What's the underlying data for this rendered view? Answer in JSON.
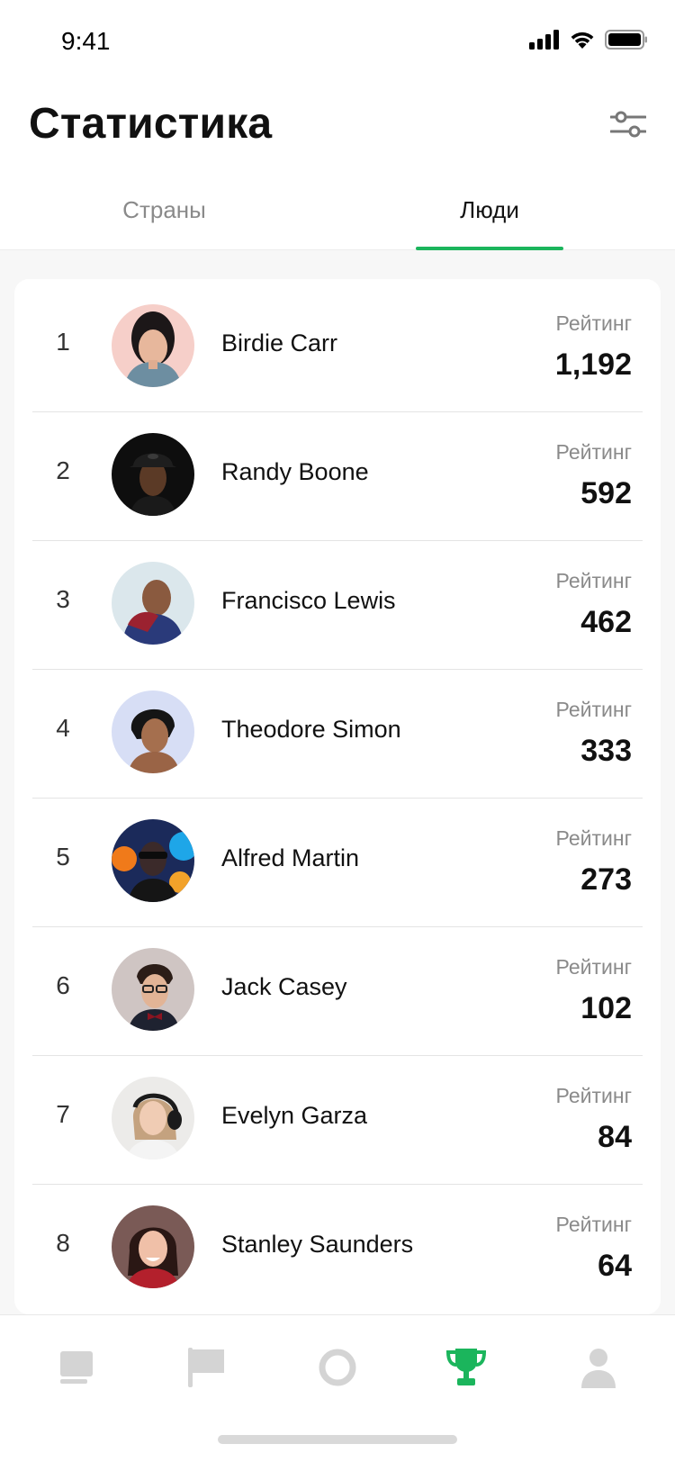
{
  "status_bar": {
    "time": "9:41"
  },
  "header": {
    "title": "Статистика"
  },
  "tabs": [
    {
      "label": "Страны",
      "active": false
    },
    {
      "label": "Люди",
      "active": true
    }
  ],
  "leaderboard": {
    "rating_label": "Рейтинг",
    "rows": [
      {
        "rank": "1",
        "name": "Birdie Carr",
        "rating": "1,192"
      },
      {
        "rank": "2",
        "name": "Randy Boone",
        "rating": "592"
      },
      {
        "rank": "3",
        "name": "Francisco Lewis",
        "rating": "462"
      },
      {
        "rank": "4",
        "name": "Theodore Simon",
        "rating": "333"
      },
      {
        "rank": "5",
        "name": "Alfred Martin",
        "rating": "273"
      },
      {
        "rank": "6",
        "name": "Jack Casey",
        "rating": "102"
      },
      {
        "rank": "7",
        "name": "Evelyn Garza",
        "rating": "84"
      },
      {
        "rank": "8",
        "name": "Stanley Saunders",
        "rating": "64"
      }
    ]
  },
  "bottom_nav": {
    "items": [
      "book-icon",
      "flag-icon",
      "ring-icon",
      "trophy-icon",
      "user-icon"
    ],
    "active": "trophy-icon"
  },
  "colors": {
    "accent": "#1bb55c",
    "inactive_icon": "#d4d4d4",
    "muted_text": "#8a8a8a"
  }
}
